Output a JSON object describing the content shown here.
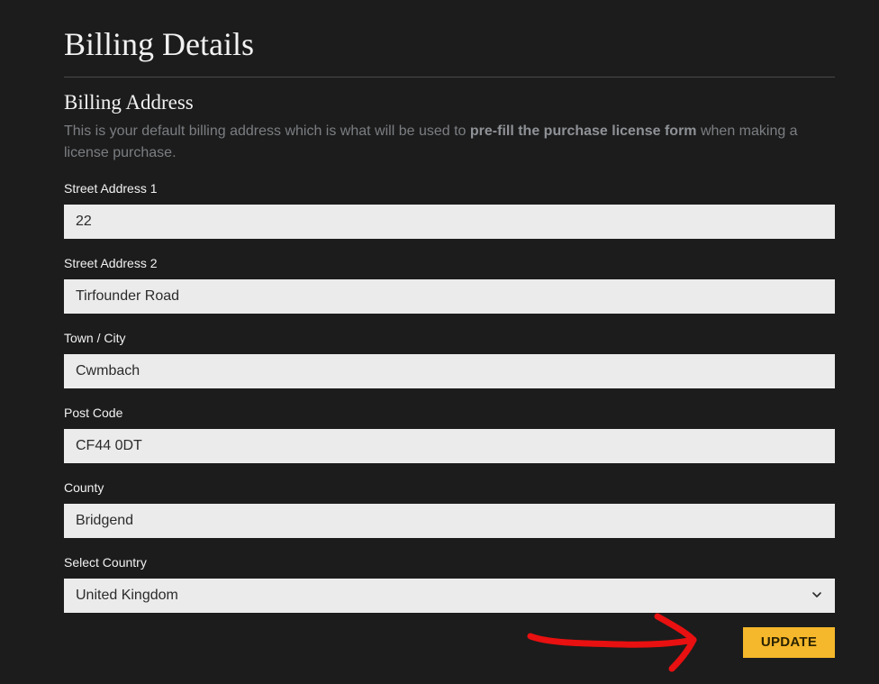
{
  "page": {
    "title": "Billing Details"
  },
  "billing_address": {
    "title": "Billing Address",
    "description_prefix": "This is your default billing address which is what will be used to ",
    "description_bold": "pre-fill the purchase license form",
    "description_suffix": " when making a license purchase."
  },
  "fields": {
    "street1": {
      "label": "Street Address 1",
      "value": "22"
    },
    "street2": {
      "label": "Street Address 2",
      "value": "Tirfounder Road"
    },
    "town": {
      "label": "Town / City",
      "value": "Cwmbach"
    },
    "postcode": {
      "label": "Post Code",
      "value": "CF44 0DT"
    },
    "county": {
      "label": "County",
      "value": "Bridgend"
    },
    "country": {
      "label": "Select Country",
      "value": "United Kingdom"
    }
  },
  "actions": {
    "update_label": "UPDATE"
  },
  "colors": {
    "background": "#1c1c1c",
    "input_background": "#ebebeb",
    "accent": "#f5b72b",
    "annotation_arrow": "#e81010"
  },
  "icons": {
    "select_chevron": "chevron-down-icon",
    "annotation": "red-arrow-annotation"
  }
}
